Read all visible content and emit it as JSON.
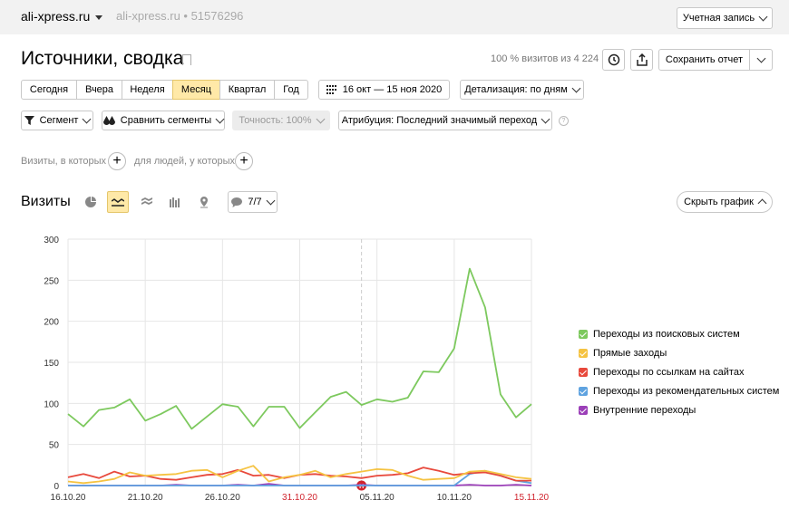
{
  "header": {
    "site": "ali-xpress.ru",
    "site_secondary": "ali-xpress.ru • 51576296",
    "account_label": "Учетная запись"
  },
  "report": {
    "title": "Источники, сводка",
    "visits_info": "100 % визитов из 4 224",
    "save_label": "Сохранить отчет"
  },
  "periods": [
    {
      "label": "Сегодня",
      "active": false
    },
    {
      "label": "Вчера",
      "active": false
    },
    {
      "label": "Неделя",
      "active": false
    },
    {
      "label": "Месяц",
      "active": true
    },
    {
      "label": "Квартал",
      "active": false
    },
    {
      "label": "Год",
      "active": false
    }
  ],
  "date_range": "16 окт — 15 ноя 2020",
  "detail_label": "Детализация: по дням",
  "filters": {
    "segment": "Сегмент",
    "compare": "Сравнить сегменты",
    "accuracy": "Точность: 100%",
    "attribution": "Атрибуция: Последний значимый переход"
  },
  "conditions": {
    "visits_where": "Визиты, в которых",
    "people_where": "для людей, у которых"
  },
  "visits_section": {
    "title": "Визиты",
    "series_count": "7/7",
    "hide_chart": "Скрыть график"
  },
  "chart_data": {
    "type": "line",
    "ylim": [
      0,
      300
    ],
    "yticks": [
      0,
      50,
      100,
      150,
      200,
      250,
      300
    ],
    "xticks": [
      {
        "label": "16.10.20",
        "index": 0,
        "holiday": false
      },
      {
        "label": "21.10.20",
        "index": 5,
        "holiday": false
      },
      {
        "label": "26.10.20",
        "index": 10,
        "holiday": false
      },
      {
        "label": "31.10.20",
        "index": 15,
        "holiday": true
      },
      {
        "label": "05.11.20",
        "index": 20,
        "holiday": false
      },
      {
        "label": "10.11.20",
        "index": 25,
        "holiday": false
      },
      {
        "label": "15.11.20",
        "index": 30,
        "holiday": true
      }
    ],
    "holiday_marker": {
      "label": "Н",
      "index": 19
    },
    "series": [
      {
        "name": "Переходы из поисковых систем",
        "color": "#7dc95e",
        "values": [
          87,
          72,
          92,
          95,
          105,
          79,
          87,
          97,
          69,
          84,
          99,
          96,
          72,
          96,
          96,
          70,
          89,
          108,
          114,
          98,
          105,
          102,
          107,
          139,
          138,
          167,
          264,
          217,
          111,
          83,
          99
        ]
      },
      {
        "name": "Прямые заходы",
        "color": "#f5c342",
        "values": [
          5,
          3,
          5,
          8,
          16,
          12,
          13,
          14,
          18,
          19,
          10,
          18,
          24,
          5,
          10,
          13,
          18,
          10,
          14,
          17,
          20,
          19,
          12,
          7,
          8,
          9,
          17,
          18,
          14,
          10,
          8
        ]
      },
      {
        "name": "Переходы по ссылкам на сайтах",
        "color": "#e8493c",
        "values": [
          10,
          14,
          9,
          17,
          11,
          12,
          8,
          7,
          10,
          13,
          14,
          19,
          12,
          13,
          9,
          13,
          14,
          12,
          11,
          9,
          12,
          13,
          15,
          22,
          18,
          13,
          15,
          16,
          12,
          6,
          6
        ]
      },
      {
        "name": "Переходы из рекомендательных систем",
        "color": "#5fa3e0",
        "values": [
          0,
          0,
          0,
          0,
          0,
          0,
          0,
          0,
          0,
          0,
          0,
          0,
          0,
          0,
          0,
          0,
          0,
          0,
          0,
          0,
          0,
          0,
          0,
          0,
          0,
          0,
          14,
          18,
          12,
          6,
          3
        ]
      },
      {
        "name": "Внутренние переходы",
        "color": "#9b3fb8",
        "values": [
          0,
          0,
          0,
          0,
          0,
          0,
          0,
          1,
          0,
          0,
          0,
          1,
          0,
          2,
          0,
          0,
          0,
          0,
          0,
          1,
          0,
          0,
          0,
          0,
          0,
          0,
          1,
          0,
          0,
          1,
          0
        ]
      }
    ]
  }
}
